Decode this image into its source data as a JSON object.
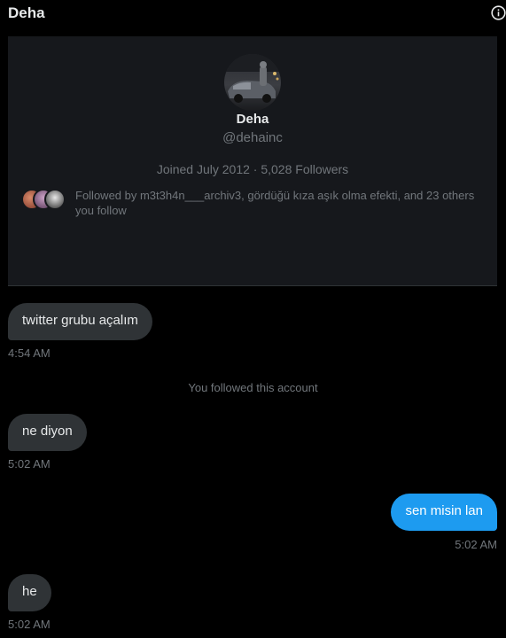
{
  "header": {
    "title": "Deha",
    "info_icon": "info-icon"
  },
  "profile": {
    "name": "Deha",
    "handle": "@dehainc",
    "meta": "Joined July 2012 · 5,028 Followers",
    "followed_by": "Followed by m3t3h4n___archiv3, gördüğü kıza aşık olma efekti, and 23 others you follow"
  },
  "messages": [
    {
      "direction": "incoming",
      "text": "twitter grubu açalım",
      "time": "4:54 AM"
    },
    {
      "system": "You followed this account"
    },
    {
      "direction": "incoming",
      "text": "ne diyon",
      "time": "5:02 AM"
    },
    {
      "direction": "outgoing",
      "text": "sen misin lan",
      "time": "5:02 AM"
    },
    {
      "direction": "incoming",
      "text": "he",
      "time": "5:02 AM"
    }
  ],
  "colors": {
    "background": "#000000",
    "card": "#16181c",
    "incoming_bubble": "#2f3336",
    "outgoing_bubble": "#1d9bf0",
    "muted_text": "#71767b",
    "primary_text": "#e7e9ea"
  }
}
